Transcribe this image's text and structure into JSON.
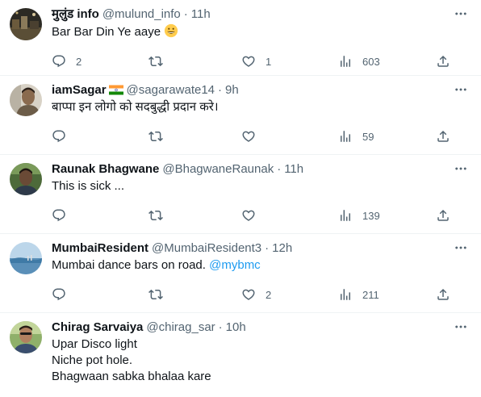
{
  "tweets": [
    {
      "name": "मुलुंड info",
      "handle": "@mulund_info",
      "sep": "·",
      "time": "11h",
      "text": "Bar Bar Din Ye aaye",
      "emoji": "grinning-face-emoji",
      "replies": "2",
      "retweets": "",
      "likes": "1",
      "views": "603"
    },
    {
      "name": "iamSagar",
      "flag": "india-flag-icon",
      "handle": "@sagarawate14",
      "sep": "·",
      "time": "9h",
      "text": "बाप्पा इन लोगो को सदबुद्धी प्रदान करे।",
      "replies": "",
      "retweets": "",
      "likes": "",
      "views": "59"
    },
    {
      "name": "Raunak Bhagwane",
      "handle": "@BhagwaneRaunak",
      "sep": "·",
      "time": "11h",
      "text": "This is sick ...",
      "replies": "",
      "retweets": "",
      "likes": "",
      "views": "139"
    },
    {
      "name": "MumbaiResident",
      "handle": "@MumbaiResident3",
      "sep": "·",
      "time": "12h",
      "text": "Mumbai dance bars on road.",
      "mention": "@mybmc",
      "replies": "",
      "retweets": "",
      "likes": "2",
      "views": "211"
    },
    {
      "name": "Chirag Sarvaiya",
      "handle": "@chirag_sar",
      "sep": "·",
      "time": "10h",
      "text": "Upar Disco light\nNiche pot hole.\nBhagwaan sabka bhalaa kare"
    }
  ],
  "icons": {
    "more": "more-horizontal-icon",
    "reply": "reply-icon",
    "retweet": "retweet-icon",
    "like": "heart-icon",
    "views": "views-chart-icon",
    "share": "share-icon"
  },
  "colors": {
    "secondary_text": "#536471",
    "link": "#1d9bf0",
    "divider": "#eff3f4"
  }
}
